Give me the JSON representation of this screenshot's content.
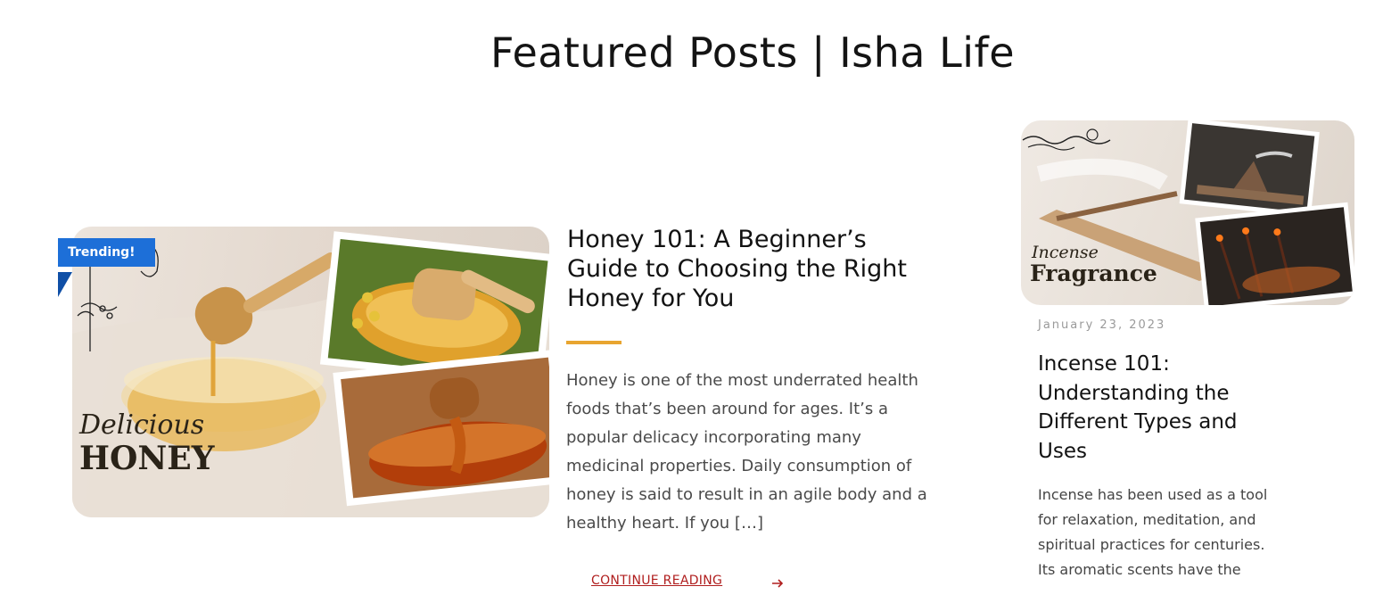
{
  "page": {
    "title": "Featured Posts | Isha Life"
  },
  "featured_post": {
    "badge": "Trending!",
    "image_caption_script": "Delicious",
    "image_caption_main": "HONEY",
    "title": "Honey 101: A Beginner’s Guide to Choosing the Right Honey for You",
    "excerpt": "Honey is one of the most underrated health foods that’s been around for ages. It’s a popular delicacy incorporating many medicinal properties. Daily consumption of honey is said to result in an agile body and a healthy heart. If you […]",
    "continue_label": "CONTINUE READING",
    "accent_color": "#e8a530",
    "badge_color": "#1d6fd8",
    "link_color": "#b01e1e"
  },
  "side_post": {
    "image_caption_script": "Incense",
    "image_caption_main": "Fragrance",
    "date": "January 23, 2023",
    "title": "Incense 101: Understanding the Different Types and Uses",
    "excerpt": "Incense has been used as a tool for relaxation, meditation, and spiritual practices for centuries. Its aromatic scents have the"
  },
  "icons": {
    "continue": "arrow-right-icon"
  }
}
